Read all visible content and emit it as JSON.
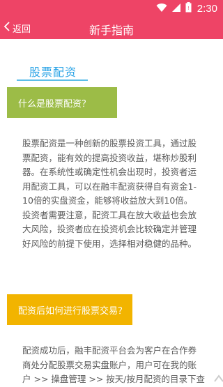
{
  "status_bar": {
    "time": "2:30"
  },
  "header": {
    "back_label": "返回",
    "title": "新手指南"
  },
  "tab": {
    "label": "股票配资"
  },
  "sections": [
    {
      "heading": "什么是股票配资？",
      "body": "股票配资是一种创新的股票投资工具，通过股\n票配资，能有效的提高投资收益，堪称炒股利\n器。在系统性或确定性机会出现时，投资者运\n用配资工具，可以在融丰配资获得自有资金1-\n10倍的实盘资金，能够将收益放大到10倍。\n投资者需要注意，配资工具在放大收益也会放\n大风险，投资者应在投资机会比较确定并管理\n好风险的前提下使用，选择相对稳健的品种。"
    },
    {
      "heading": "配资后如何进行股票交易？",
      "body": "配资成功后，融丰配资平台会为客户在合作券\n商处分配股票交易实盘账户，用户可在我的账\n户 >> 操盘管理 >> 按天/按月配资的目录下查"
    }
  ],
  "colors": {
    "brand": "#ee4466",
    "tab_accent": "#29a3e6",
    "section1_bg": "#9cbc47",
    "section2_bg": "#f2b400"
  }
}
